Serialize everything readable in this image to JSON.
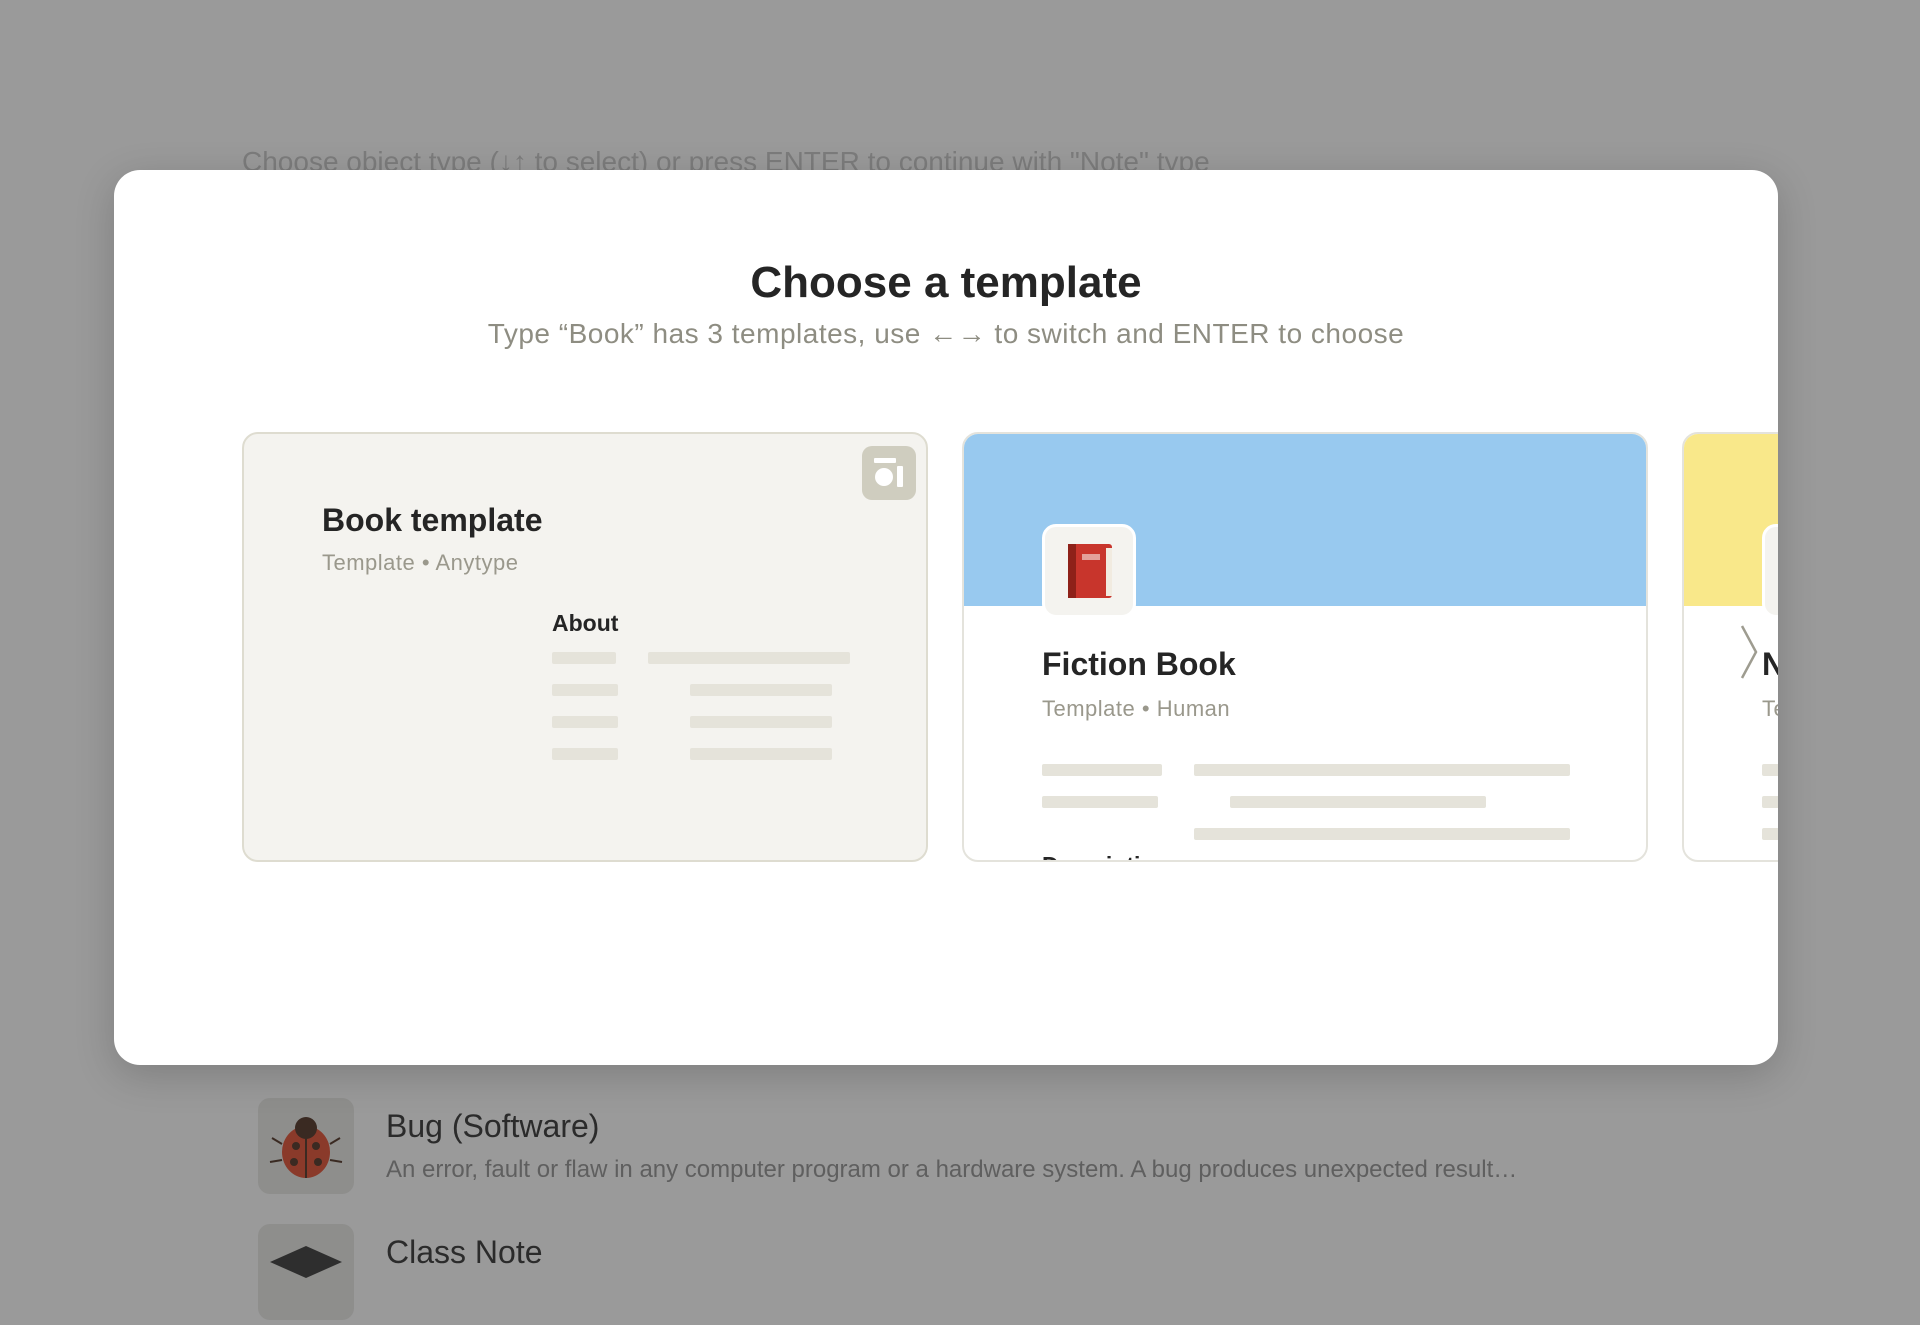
{
  "background": {
    "hint": "Choose object type (↓↑ to select) or press ENTER to continue with \"Note\" type",
    "items": [
      {
        "title": "Bug (Software)",
        "description": "An error, fault or flaw in any computer program or a hardware system. A bug produces unexpected result…",
        "icon": "ladybug-icon"
      },
      {
        "title": "Class Note",
        "description": "",
        "icon": "graduation-cap-icon"
      }
    ]
  },
  "modal": {
    "title": "Choose a template",
    "subtitle": "Type “Book” has 3 templates, use ←→ to switch and ENTER to choose",
    "templates": [
      {
        "title": "Book template",
        "meta": "Template • Anytype",
        "section": "About",
        "badge": "anytype-logo-icon"
      },
      {
        "title": "Fiction Book",
        "meta": "Template • Human",
        "section": "Description",
        "cover_color": "#98c9ef",
        "icon": "red-book-icon"
      },
      {
        "title": "N",
        "meta": "Te",
        "cover_color": "#f9e88a"
      }
    ],
    "next_arrow": "chevron-right-icon"
  }
}
